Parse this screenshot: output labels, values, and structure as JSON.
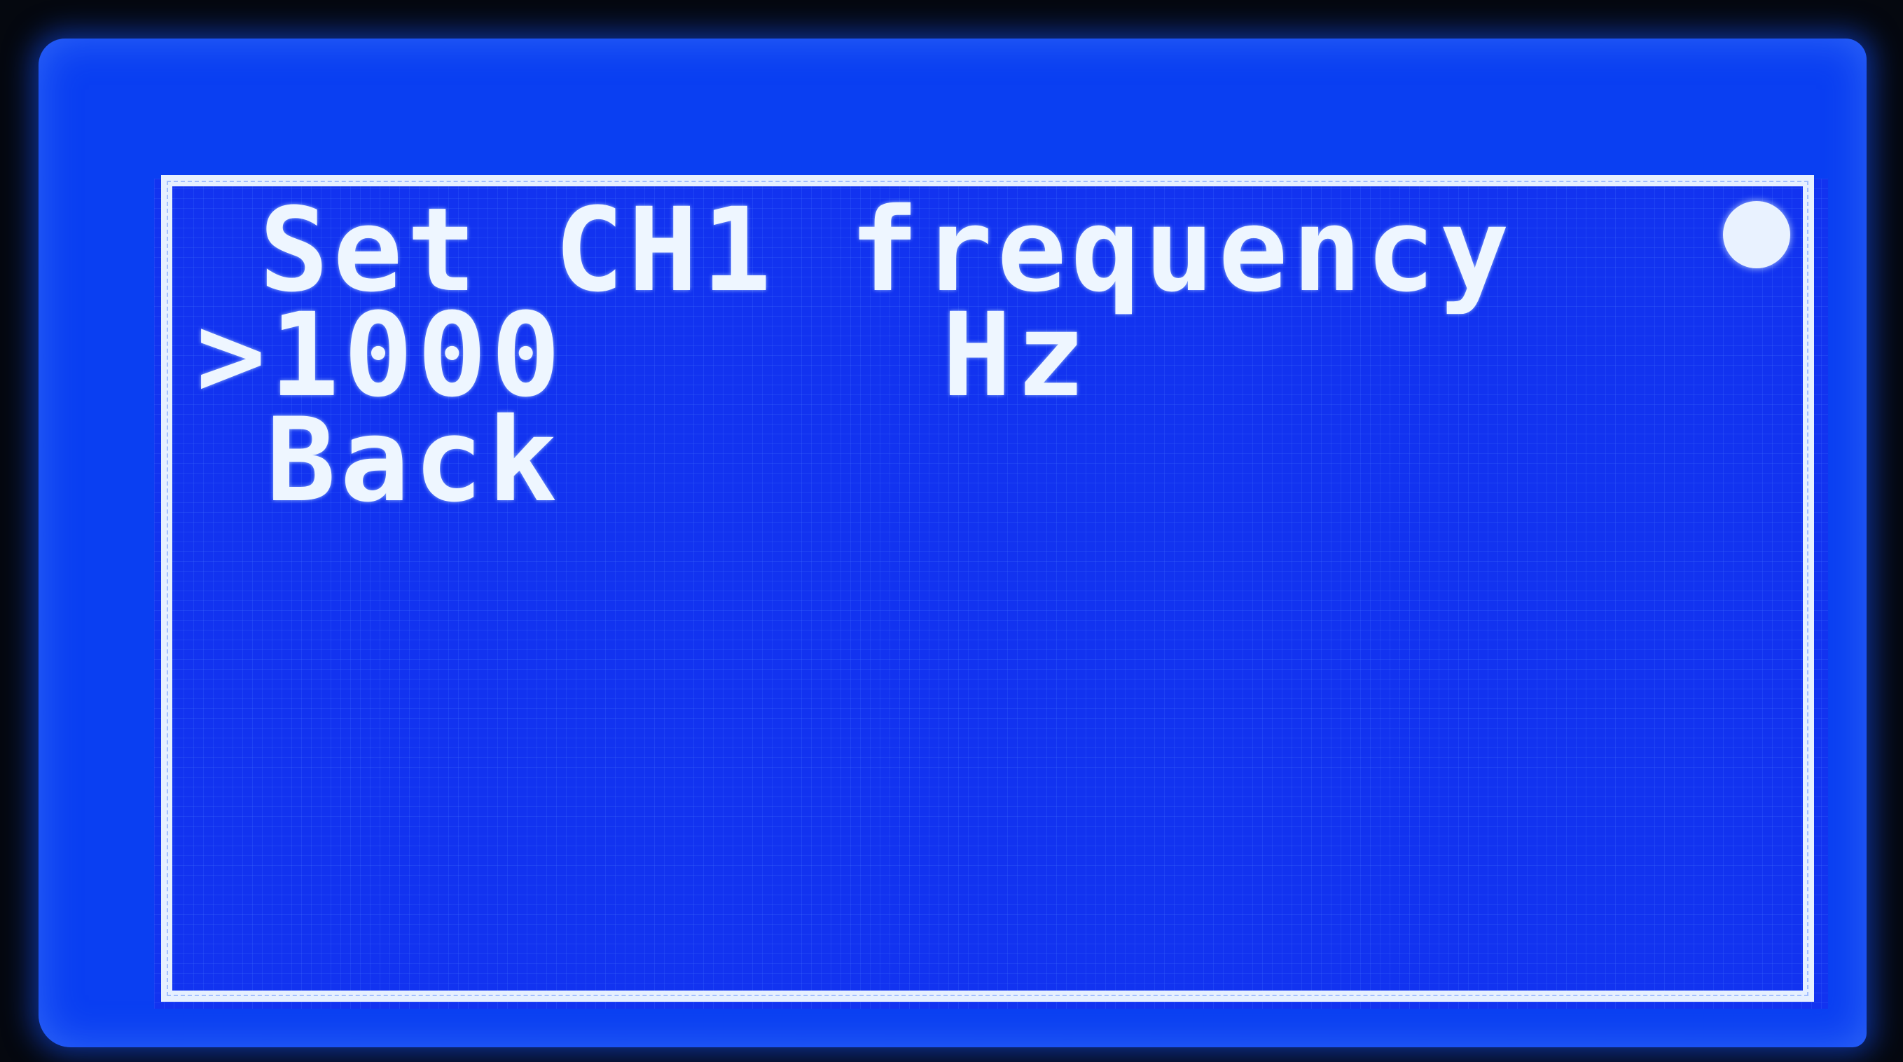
{
  "screen": {
    "title": "Set CH1 frequency",
    "selection_marker": ">",
    "frequency_value": "1000",
    "frequency_unit": "Hz",
    "back_label": "Back"
  },
  "colors": {
    "backlight": "#0a3ff2",
    "text": "#eef6ff"
  },
  "icons": {
    "status_indicator": "filled-circle-icon"
  }
}
